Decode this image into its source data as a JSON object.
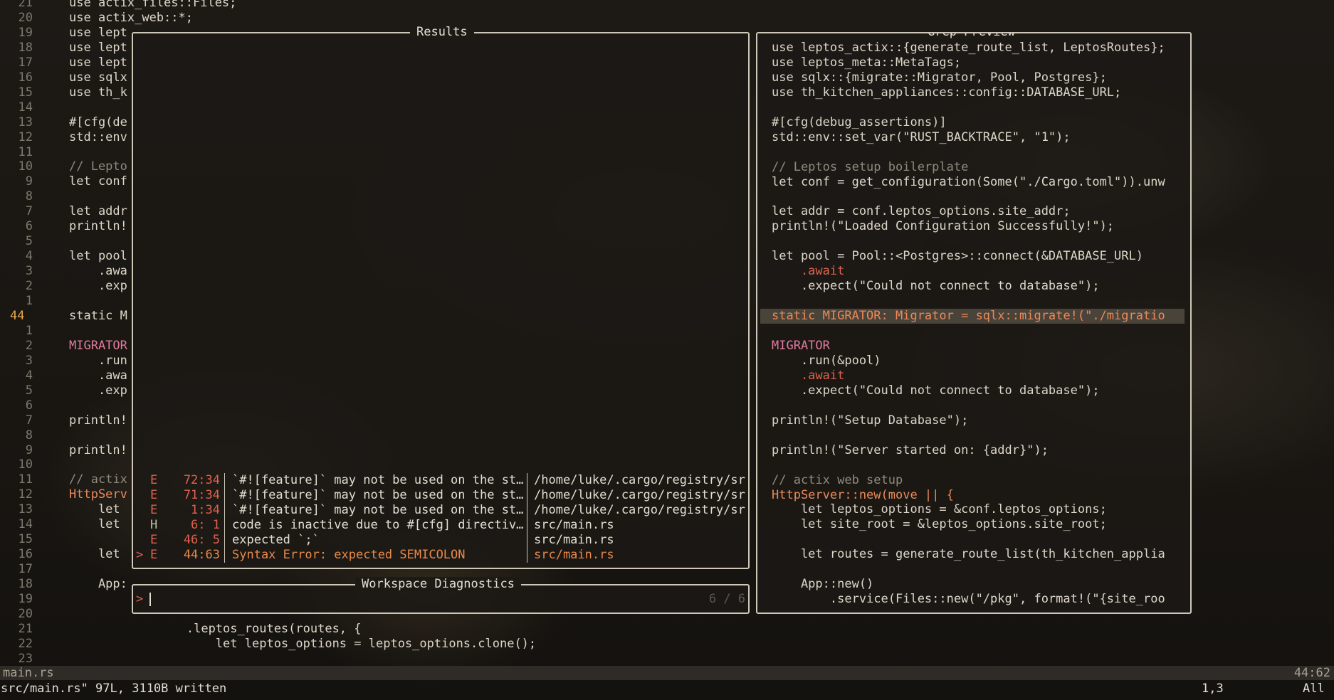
{
  "editor": {
    "numbers": [
      "21",
      "20",
      "19",
      "18",
      "17",
      "16",
      "15",
      "14",
      "13",
      "12",
      "11",
      "10",
      "9",
      "8",
      "7",
      "6",
      "5",
      "4",
      "3",
      "2",
      "1",
      "44",
      "1",
      "2",
      "3",
      "4",
      "5",
      "6",
      "7",
      "8",
      "9",
      "10",
      "11",
      "12",
      "13",
      "14",
      "15",
      "16",
      "17",
      "18",
      "19",
      "20",
      "21",
      "22",
      "23"
    ],
    "lines": [
      {
        "t": "use actix_files::Files;",
        "k": "top"
      },
      {
        "t": "use actix_web::*;"
      },
      {
        "t": "use lept"
      },
      {
        "t": "use lept"
      },
      {
        "t": "use lept"
      },
      {
        "t": "use sqlx"
      },
      {
        "t": "use th_k"
      },
      {
        "t": ""
      },
      {
        "t": "#[cfg(de"
      },
      {
        "t": "std::env"
      },
      {
        "t": ""
      },
      {
        "t": "// Lepto",
        "c": "cm"
      },
      {
        "t": "let conf"
      },
      {
        "t": ""
      },
      {
        "t": "let addr"
      },
      {
        "t": "println!"
      },
      {
        "t": ""
      },
      {
        "t": "let pool"
      },
      {
        "t": "    .awa"
      },
      {
        "t": "    .exp"
      },
      {
        "t": ""
      },
      {
        "t": "static M"
      },
      {
        "t": ""
      },
      {
        "t": "MIGRATOR",
        "c": "cs"
      },
      {
        "t": "    .run"
      },
      {
        "t": "    .awa"
      },
      {
        "t": "    .exp"
      },
      {
        "t": ""
      },
      {
        "t": "println!"
      },
      {
        "t": ""
      },
      {
        "t": "println!"
      },
      {
        "t": ""
      },
      {
        "t": "// actix",
        "c": "cm"
      },
      {
        "t": "HttpServ",
        "c": "ty"
      },
      {
        "t": "    let"
      },
      {
        "t": "    let"
      },
      {
        "t": ""
      },
      {
        "t": "    let"
      },
      {
        "t": ""
      },
      {
        "t": "    App:"
      },
      {
        "t": ""
      },
      {
        "t": ""
      },
      {
        "t": "        .leptos_routes(routes, {"
      },
      {
        "t": "            let leptos_options = leptos_options.clone();"
      },
      {
        "t": ""
      }
    ]
  },
  "results": {
    "title": "Results",
    "rows": [
      {
        "sel": "",
        "sev": "E",
        "pos": "72:34",
        "msg": "`#![feature]` may not be used on the st…",
        "file": "/home/luke/.cargo/registry/sr"
      },
      {
        "sel": "",
        "sev": "E",
        "pos": "71:34",
        "msg": "`#![feature]` may not be used on the st…",
        "file": "/home/luke/.cargo/registry/sr"
      },
      {
        "sel": "",
        "sev": "E",
        "pos": "1:34",
        "msg": "`#![feature]` may not be used on the st…",
        "file": "/home/luke/.cargo/registry/sr"
      },
      {
        "sel": "",
        "sev": "H",
        "pos": "6: 1",
        "msg": "code is inactive due to #[cfg] directiv…",
        "file": "src/main.rs"
      },
      {
        "sel": "",
        "sev": "E",
        "pos": "46: 5",
        "msg": "expected `;`",
        "file": "src/main.rs"
      },
      {
        "sel": ">",
        "sev": "E",
        "pos": "44:63",
        "msg": "Syntax Error: expected SEMICOLON",
        "file": "src/main.rs"
      }
    ]
  },
  "prompt": {
    "title": "Workspace Diagnostics",
    "symbol": ">",
    "count": "6 / 6"
  },
  "preview": {
    "title": "Grep Preview",
    "lines": [
      "use leptos_actix::{generate_route_list, LeptosRoutes};",
      "use leptos_meta::MetaTags;",
      "use sqlx::{migrate::Migrator, Pool, Postgres};",
      "use th_kitchen_appliances::config::DATABASE_URL;",
      "",
      "#[cfg(debug_assertions)]",
      "std::env::set_var(\"RUST_BACKTRACE\", \"1\");",
      "",
      "// Leptos setup boilerplate",
      "let conf = get_configuration(Some(\"./Cargo.toml\")).unw",
      "",
      "let addr = conf.leptos_options.site_addr;",
      "println!(\"Loaded Configuration Successfully!\");",
      "",
      "let pool = Pool::<Postgres>::connect(&DATABASE_URL)",
      "    .await",
      "    .expect(\"Could not connect to database\");",
      "",
      "static MIGRATOR: Migrator = sqlx::migrate!(\"./migratio",
      "",
      "MIGRATOR",
      "    .run(&pool)",
      "    .await",
      "    .expect(\"Could not connect to database\");",
      "",
      "println!(\"Setup Database\");",
      "",
      "println!(\"Server started on: {addr}\");",
      "",
      "// actix web setup",
      "HttpServer::new(move || {",
      "    let leptos_options = &conf.leptos_options;",
      "    let site_root = &leptos_options.site_root;",
      "",
      "    let routes = generate_route_list(th_kitchen_applia",
      "",
      "    App::new()",
      "        .service(Files::new(\"/pkg\", format!(\"{site_roo"
    ]
  },
  "status": {
    "filename": "main.rs",
    "position": "44:62"
  },
  "cmdline": {
    "message": "src/main.rs\" 97L, 3110B written",
    "cursor": "1,3",
    "scroll": "All"
  },
  "colors": {
    "accent": "#e6a64b",
    "error": "#e0624e",
    "selected": "#e8894a"
  }
}
